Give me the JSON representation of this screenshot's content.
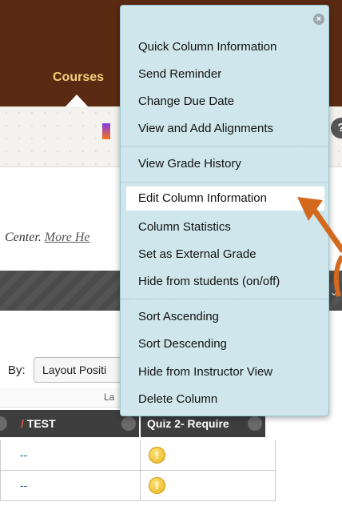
{
  "header": {
    "courses_tab": "Courses"
  },
  "toolbar": {
    "help_glyph": "?"
  },
  "page": {
    "center_text": "Center.",
    "more_link": "More He"
  },
  "sort": {
    "label": "By:",
    "selected": "Layout Positi"
  },
  "layout_row_text": "La",
  "columns": [
    {
      "label": "TEST",
      "marker": "/"
    },
    {
      "label": "Quiz 2- Require"
    }
  ],
  "rows": [
    {
      "test_value": "--",
      "quiz_icon": "warning-icon"
    },
    {
      "test_value": "--",
      "quiz_icon": "warning-icon"
    }
  ],
  "context_menu": {
    "close_glyph": "×",
    "items": [
      "Quick Column Information",
      "Send Reminder",
      "Change Due Date",
      "View and Add Alignments",
      "View Grade History",
      "Edit Column Information",
      "Column Statistics",
      "Set as External Grade",
      "Hide from students (on/off)",
      "Sort Ascending",
      "Sort Descending",
      "Hide from Instructor View",
      "Delete Column"
    ],
    "highlighted_item": "Edit Column Information"
  },
  "colors": {
    "header_bg": "#5b2a12",
    "tab_text": "#f2d07a",
    "menu_bg": "#cfe6ed",
    "annotation": "#d2691e"
  }
}
